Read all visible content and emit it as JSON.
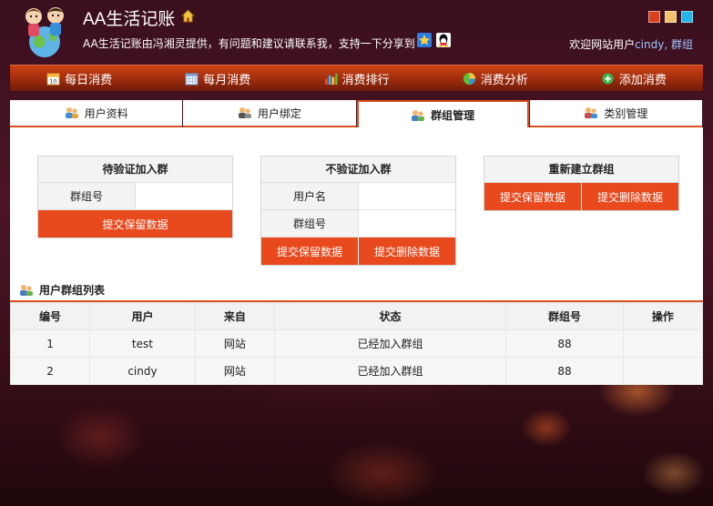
{
  "header": {
    "title": "AA生活记账",
    "tagline": "AA生活记账由冯湘灵提供，有问题和建议请联系我，支持一下分享到",
    "welcome_prefix": "欢迎网站用户",
    "username": "cindy,",
    "group_link": "群组",
    "theme_colors": [
      "#d9411e",
      "#f2bf6a",
      "#22b5e8"
    ]
  },
  "nav": {
    "items": [
      {
        "label": "每日消费",
        "icon": "calendar-icon"
      },
      {
        "label": "每月消费",
        "icon": "calendar-grid-icon"
      },
      {
        "label": "消费排行",
        "icon": "bar-chart-icon"
      },
      {
        "label": "消费分析",
        "icon": "pie-chart-icon"
      },
      {
        "label": "添加消费",
        "icon": "add-circle-icon"
      }
    ]
  },
  "subtabs": {
    "items": [
      {
        "label": "用户资料",
        "active": false
      },
      {
        "label": "用户绑定",
        "active": false
      },
      {
        "label": "群组管理",
        "active": true
      },
      {
        "label": "类别管理",
        "active": false
      }
    ]
  },
  "join_verify": {
    "title": "待验证加入群",
    "group_label": "群组号",
    "group_value": "",
    "submit_label": "提交保留数据"
  },
  "join_no_verify": {
    "title": "不验证加入群",
    "user_label": "用户名",
    "user_value": "",
    "group_label": "群组号",
    "group_value": "",
    "submit_keep_label": "提交保留数据",
    "submit_delete_label": "提交删除数据"
  },
  "rebuild_group": {
    "title": "重新建立群组",
    "submit_keep_label": "提交保留数据",
    "submit_delete_label": "提交删除数据"
  },
  "group_list": {
    "title": "用户群组列表",
    "columns": [
      "编号",
      "用户",
      "来自",
      "状态",
      "群组号",
      "操作"
    ],
    "rows": [
      [
        "1",
        "test",
        "网站",
        "已经加入群组",
        "88",
        ""
      ],
      [
        "2",
        "cindy",
        "网站",
        "已经加入群组",
        "88",
        ""
      ]
    ]
  }
}
